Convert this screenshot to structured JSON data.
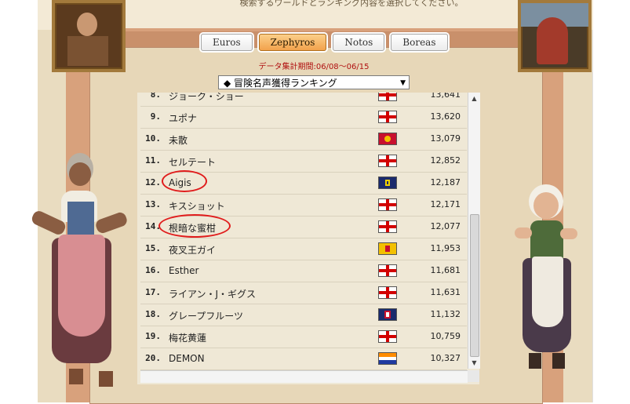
{
  "header": {
    "instruction": "検索するワールドとランキング内容を選択してください。"
  },
  "tabs": [
    {
      "label": "Euros",
      "active": false
    },
    {
      "label": "Zephyros",
      "active": true
    },
    {
      "label": "Notos",
      "active": false
    },
    {
      "label": "Boreas",
      "active": false
    }
  ],
  "period_label": "データ集計期間:06/08〜06/15",
  "ranking_select": {
    "value": "◆ 冒険名声獲得ランキング"
  },
  "rows": [
    {
      "rank": "8.",
      "name": "ジョーク・ショー",
      "flag": "england",
      "score": "13,641"
    },
    {
      "rank": "9.",
      "name": "ユポナ",
      "flag": "england",
      "score": "13,620"
    },
    {
      "rank": "10.",
      "name": "未散",
      "flag": "venice",
      "score": "13,079"
    },
    {
      "rank": "11.",
      "name": "セルテート",
      "flag": "england",
      "score": "12,852"
    },
    {
      "rank": "12.",
      "name": "Aigis",
      "flag": "navy",
      "score": "12,187"
    },
    {
      "rank": "13.",
      "name": "キスショット",
      "flag": "england",
      "score": "12,171"
    },
    {
      "rank": "14.",
      "name": "根暗な蜜柑",
      "flag": "england",
      "score": "12,077"
    },
    {
      "rank": "15.",
      "name": "夜叉王ガイ",
      "flag": "spain",
      "score": "11,953"
    },
    {
      "rank": "16.",
      "name": "Esther",
      "flag": "england",
      "score": "11,681"
    },
    {
      "rank": "17.",
      "name": "ライアン・J・ギグス",
      "flag": "england",
      "score": "11,631"
    },
    {
      "rank": "18.",
      "name": "グレープフルーツ",
      "flag": "navyred",
      "score": "11,132"
    },
    {
      "rank": "19.",
      "name": "梅花黄蓮",
      "flag": "england",
      "score": "10,759"
    },
    {
      "rank": "20.",
      "name": "DEMON",
      "flag": "holland",
      "score": "10,327"
    }
  ],
  "colors": {
    "accent_tab": "#f2a24c",
    "period_text": "#b01010",
    "highlight_circle": "#e01c1c"
  }
}
